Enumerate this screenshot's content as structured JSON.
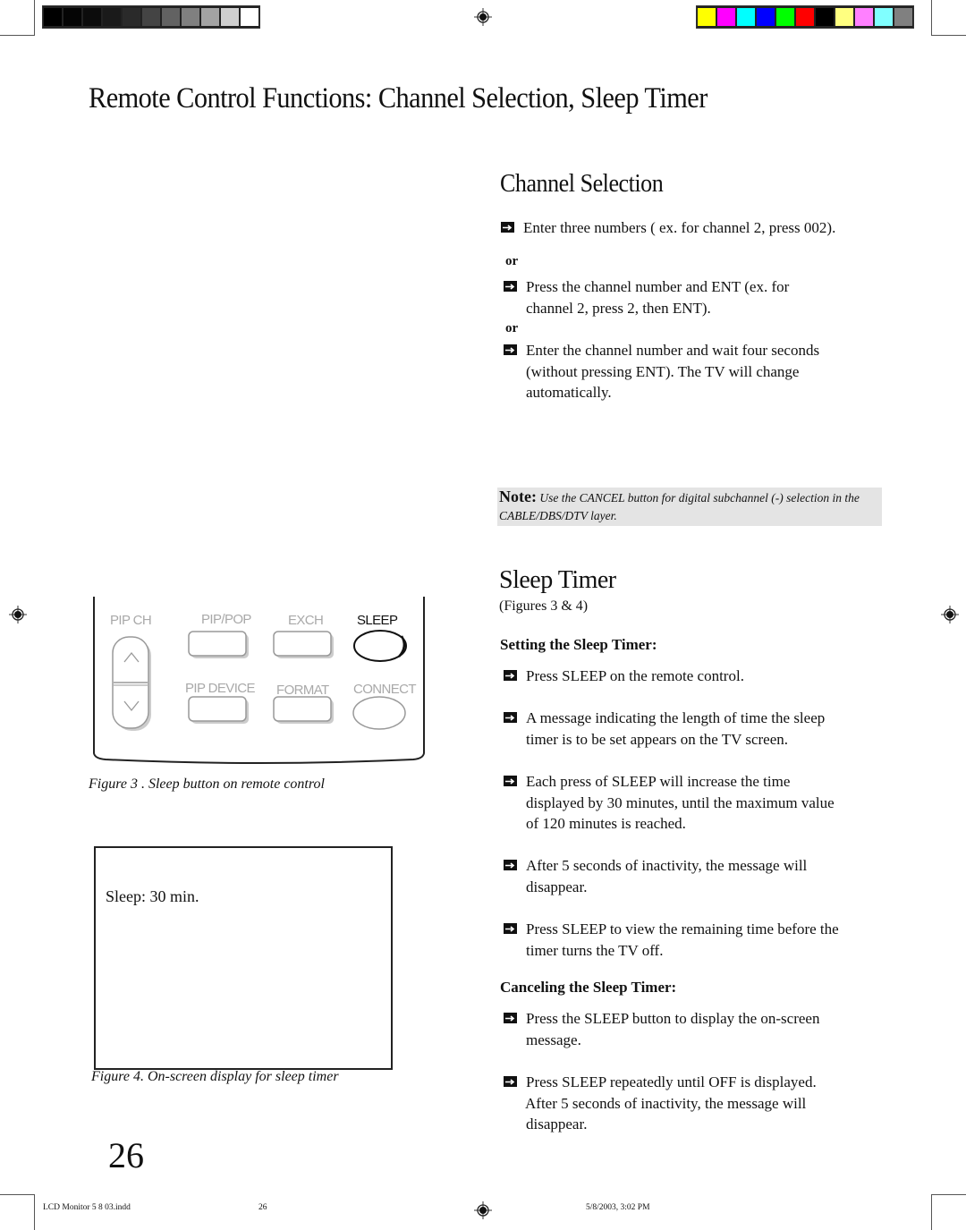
{
  "print_marks": {
    "gray_bar": [
      "#000000",
      "#050505",
      "#0c0c0c",
      "#1a1a1a",
      "#2a2a2a",
      "#444444",
      "#626262",
      "#808080",
      "#a3a3a3",
      "#cfcfcf",
      "#ffffff"
    ],
    "color_bar": [
      "#ffff00",
      "#ff00ff",
      "#00ffff",
      "#0000ff",
      "#00ff00",
      "#ff0000",
      "#000000",
      "#ffff80",
      "#ff80ff",
      "#80ffff",
      "#808080"
    ]
  },
  "page": {
    "title": "Remote Control Functions: Channel Selection, Sleep Timer",
    "page_number": "26"
  },
  "channel_selection": {
    "heading": "Channel Selection",
    "or_label": "or",
    "steps": [
      {
        "line1": "Enter three numbers ( ex. for channel 2, press 002)."
      },
      {
        "line1": "Press the channel number and ENT (ex. for",
        "line2": "channel 2, press 2, then ENT)."
      },
      {
        "line1": "Enter the channel number and wait four seconds",
        "line2": "(without pressing ENT).  The TV will change",
        "line3": "automatically."
      }
    ],
    "note": {
      "label": "Note:",
      "text": "Use  the CANCEL button for digital subchannel (-) selection in the CABLE/DBS/DTV layer."
    }
  },
  "sleep_timer": {
    "heading": "Sleep Timer",
    "figures_ref": "(Figures 3 & 4)",
    "setting": {
      "heading": "Setting the Sleep Timer:",
      "steps": [
        {
          "line1": "Press SLEEP on the remote control."
        },
        {
          "line1": "A message indicating the length of time the sleep",
          "line2": "timer is to be set appears on the TV screen."
        },
        {
          "line1": "Each press of SLEEP will increase the time",
          "line2": "displayed by 30 minutes, until the maximum value",
          "line3": "of 120 minutes is reached."
        },
        {
          "line1": "After 5 seconds of inactivity, the message will",
          "line2": "disappear."
        },
        {
          "line1": "Press SLEEP to view the remaining time before the",
          "line2": "timer turns the TV off."
        }
      ]
    },
    "canceling": {
      "heading": "Canceling the Sleep Timer:",
      "steps": [
        {
          "line1": "Press the SLEEP button to display the on-screen",
          "line2": "message."
        },
        {
          "line1": "Press SLEEP repeatedly until OFF is displayed.",
          "line2": "After 5 seconds of inactivity, the message will",
          "line3": "disappear."
        }
      ]
    }
  },
  "figure3": {
    "caption": "Figure 3 . Sleep button on remote control",
    "buttons": {
      "pip_ch": "PIP CH",
      "pip_pop": "PIP/POP",
      "exch": "EXCH",
      "sleep": "SLEEP",
      "pip_device": "PIP DEVICE",
      "format": "FORMAT",
      "connect": "CONNECT"
    }
  },
  "figure4": {
    "caption": "Figure 4. On-screen display for sleep timer",
    "osd_message": "Sleep: 30 min."
  },
  "slug": {
    "filename": "LCD Monitor 5 8 03.indd",
    "page": "26",
    "timestamp": "5/8/2003, 3:02 PM"
  }
}
